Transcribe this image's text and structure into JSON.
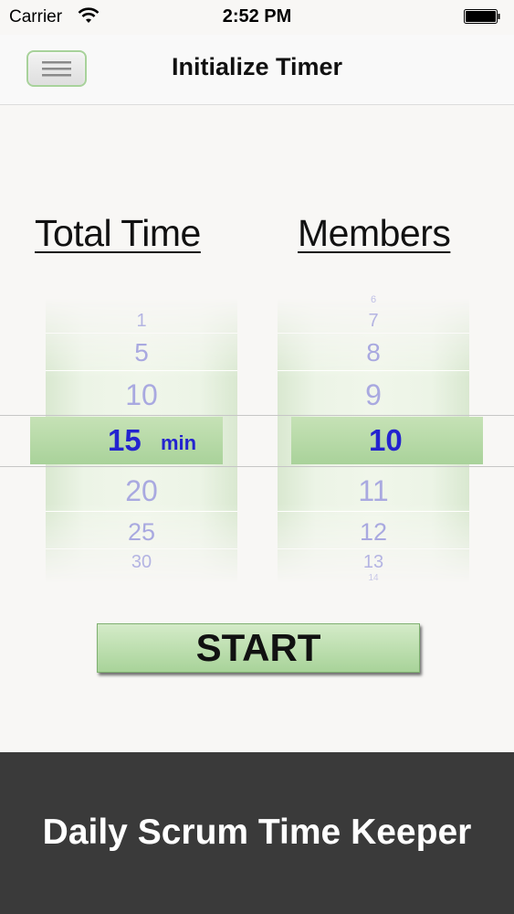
{
  "status_bar": {
    "carrier": "Carrier",
    "time": "2:52 PM",
    "wifi_icon": "wifi-icon",
    "battery_icon": "battery-icon"
  },
  "nav": {
    "title": "Initialize Timer",
    "menu_icon": "hamburger-menu-icon"
  },
  "picker": {
    "total_time": {
      "heading": "Total Time",
      "values": [
        "1",
        "5",
        "10",
        "15",
        "20",
        "25",
        "30"
      ],
      "selected": "15",
      "unit": "min"
    },
    "members": {
      "heading": "Members",
      "values": [
        "6",
        "7",
        "8",
        "9",
        "10",
        "11",
        "12",
        "13",
        "14"
      ],
      "selected": "10"
    }
  },
  "start_button": {
    "label": "START"
  },
  "footer": {
    "title": "Daily Scrum Time Keeper"
  },
  "colors": {
    "accent_green": "#a9d29a",
    "selected_text": "#2323cf",
    "unselected_text": "#a9a9e0",
    "footer_bg": "#3a3a3a"
  }
}
